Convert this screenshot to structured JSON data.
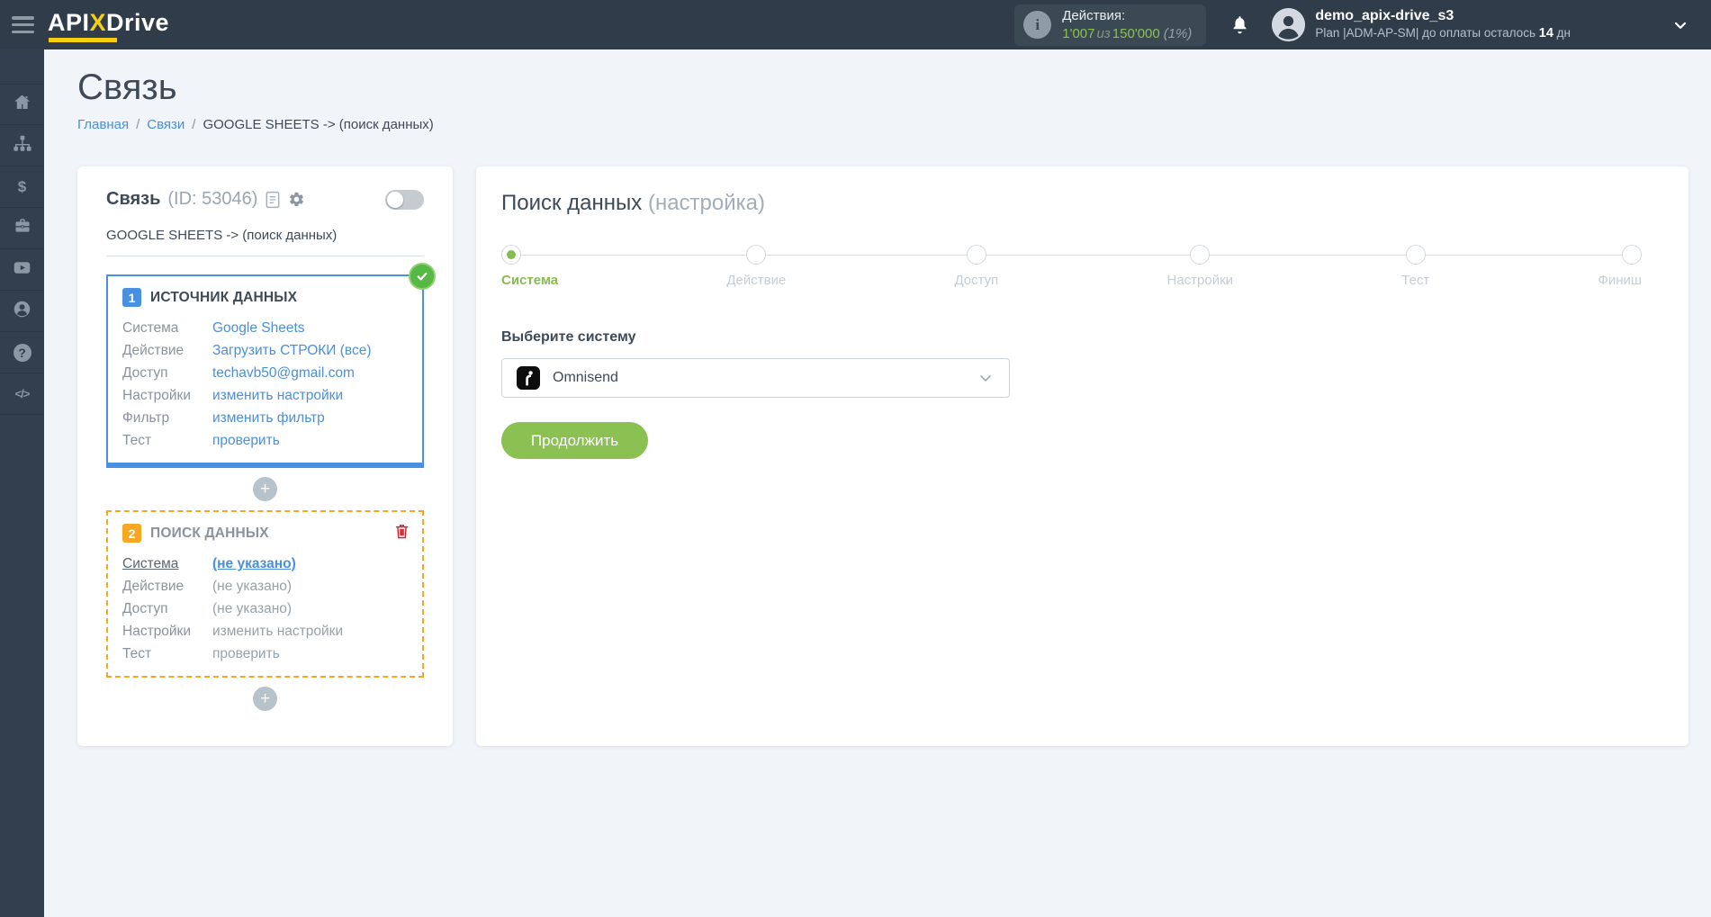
{
  "header": {
    "logo": {
      "api": "API",
      "x": "X",
      "drive": "Drive"
    },
    "actions_counter": {
      "title": "Действия:",
      "used": "1'007",
      "of": "из",
      "total": "150'000",
      "percent": "(1%)",
      "info_glyph": "i"
    },
    "user": {
      "name": "demo_apix-drive_s3",
      "plan": "Plan |ADM-AP-SM| до оплаты осталось",
      "days": "14",
      "days_unit": "дн"
    }
  },
  "sidebar": {
    "icons": [
      "home",
      "connections",
      "billing",
      "services",
      "video",
      "profile",
      "help",
      "api"
    ],
    "glyphs": {
      "dollar": "$",
      "question": "?",
      "code": "</>"
    }
  },
  "page": {
    "title": "Связь",
    "breadcrumb": {
      "home": "Главная",
      "separator": "/",
      "connections": "Связи",
      "current": "GOOGLE SHEETS -> (поиск данных)"
    }
  },
  "connection_card": {
    "title": "Связь",
    "id": "(ID: 53046)",
    "subtitle": "GOOGLE SHEETS -> (поиск данных)",
    "add_glyph": "+",
    "source_box": {
      "number": "1",
      "title": "ИСТОЧНИК ДАННЫХ",
      "rows": [
        {
          "label": "Система",
          "value": "Google Sheets"
        },
        {
          "label": "Действие",
          "value": "Загрузить СТРОКИ (все)"
        },
        {
          "label": "Доступ",
          "value": "techavb50@gmail.com"
        },
        {
          "label": "Настройки",
          "value": "изменить настройки"
        },
        {
          "label": "Фильтр",
          "value": "изменить фильтр"
        },
        {
          "label": "Тест",
          "value": "проверить"
        }
      ]
    },
    "search_box": {
      "number": "2",
      "title": "ПОИСК ДАННЫХ",
      "rows": [
        {
          "label": "Система",
          "value": "(не указано)"
        },
        {
          "label": "Действие",
          "value": "(не указано)"
        },
        {
          "label": "Доступ",
          "value": "(не указано)"
        },
        {
          "label": "Настройки",
          "value": "изменить настройки"
        },
        {
          "label": "Тест",
          "value": "проверить"
        }
      ]
    }
  },
  "setup_panel": {
    "title": "Поиск данных",
    "subtitle": "(настройка)",
    "steps": [
      {
        "label": "Система",
        "state": "active"
      },
      {
        "label": "Действие",
        "state": "upcoming"
      },
      {
        "label": "Доступ",
        "state": "upcoming"
      },
      {
        "label": "Настройки",
        "state": "upcoming"
      },
      {
        "label": "Тест",
        "state": "upcoming"
      },
      {
        "label": "Финиш",
        "state": "upcoming"
      }
    ],
    "system_select": {
      "label": "Выберите систему",
      "value": "Omnisend"
    },
    "continue_label": "Продолжить"
  },
  "colors": {
    "header_dark": "#303c49",
    "sidebar_dark": "#333f4e",
    "background": "#f1f4f9",
    "accent_green": "#8bc053",
    "step_active_green": "#87bd4d",
    "counter_green": "#8cc152",
    "link_blue": "#4a90d9",
    "source_border_blue": "#4a90e2",
    "search_border_orange": "#f6a723",
    "delete_red": "#c32431",
    "logo_yellow": "#f7cf0d"
  }
}
